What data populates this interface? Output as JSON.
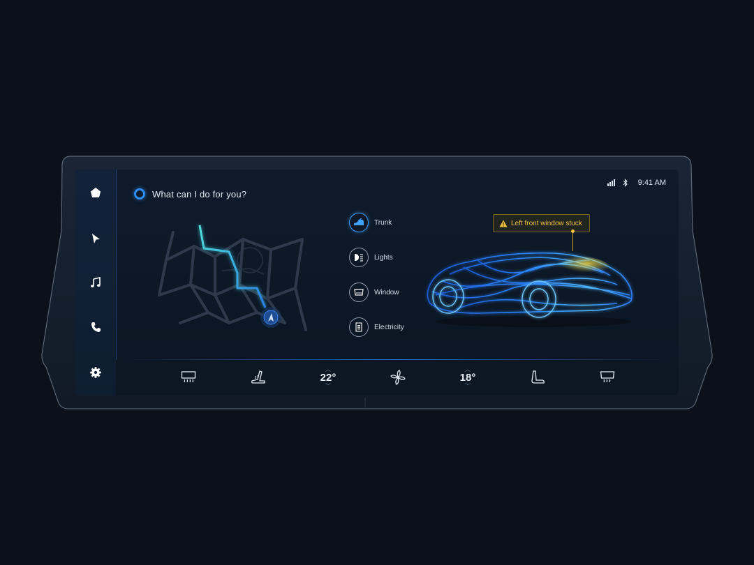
{
  "status_bar": {
    "time": "9:41 AM",
    "icons": [
      "signal-icon",
      "bluetooth-icon"
    ]
  },
  "assistant": {
    "prompt": "What can I do for you?"
  },
  "sidebar": {
    "items": [
      {
        "name": "home",
        "icon": "home-icon"
      },
      {
        "name": "navigation",
        "icon": "navigation-arrow-icon"
      },
      {
        "name": "music",
        "icon": "music-note-icon"
      },
      {
        "name": "phone",
        "icon": "phone-icon"
      },
      {
        "name": "settings",
        "icon": "gear-icon"
      }
    ]
  },
  "vehicle_controls": [
    {
      "label": "Trunk",
      "icon": "trunk-icon",
      "active": true
    },
    {
      "label": "Lights",
      "icon": "headlight-icon",
      "active": false
    },
    {
      "label": "Window",
      "icon": "window-icon",
      "active": false
    },
    {
      "label": "Electricity",
      "icon": "battery-icon",
      "active": false
    }
  ],
  "alert": {
    "message": "Left front window stuck",
    "icon": "warning-icon"
  },
  "climate": {
    "driver_temp": "22°",
    "passenger_temp": "18°",
    "items": [
      "rear-defrost-icon",
      "seat-heat-icon",
      "fan-icon",
      "seat-icon",
      "front-defrost-icon"
    ]
  },
  "colors": {
    "accent": "#2a8cf0",
    "route": "#35c8d8",
    "alert": "#f0c341",
    "background": "#0a111b"
  }
}
